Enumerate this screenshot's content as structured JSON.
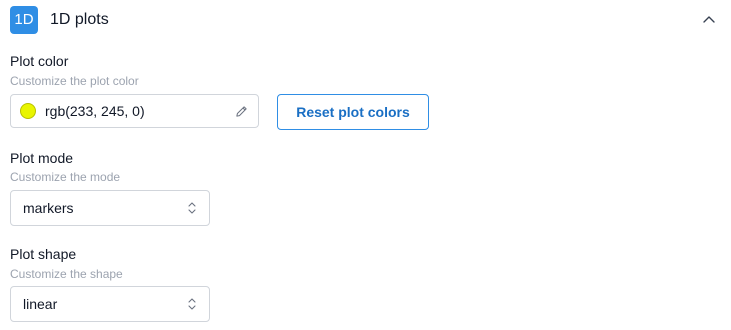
{
  "section": {
    "badge": "1D",
    "title": "1D plots",
    "collapse_icon": "chevron-up-icon"
  },
  "plot_color": {
    "label": "Plot color",
    "description": "Customize the plot color",
    "value": "rgb(233, 245, 0)",
    "swatch_color": "#e9f500",
    "edit_icon": "pencil-icon",
    "reset_label": "Reset plot colors"
  },
  "plot_mode": {
    "label": "Plot mode",
    "description": "Customize the mode",
    "value": "markers",
    "arrows_icon": "select-arrows-icon"
  },
  "plot_shape": {
    "label": "Plot shape",
    "description": "Customize the shape",
    "value": "linear",
    "arrows_icon": "select-arrows-icon"
  },
  "colors": {
    "accent": "#2f8ee5",
    "button_text": "#1a6fc4",
    "border": "#d1d5db",
    "muted_text": "#9ca3af"
  }
}
